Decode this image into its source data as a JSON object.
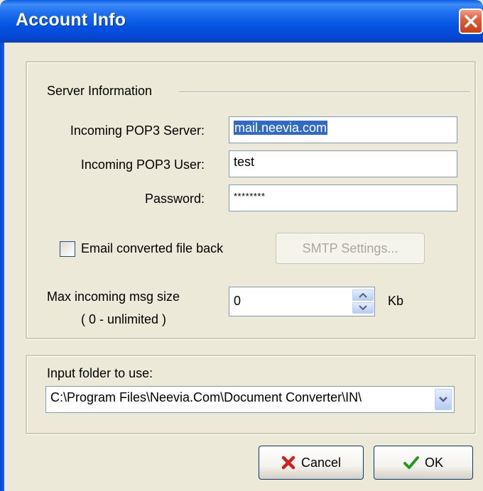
{
  "window": {
    "title": "Account Info"
  },
  "server_info": {
    "group_label": "Server Information",
    "pop3_server_label": "Incoming POP3 Server:",
    "pop3_server_value": "mail.neevia.com",
    "pop3_user_label": "Incoming POP3 User:",
    "pop3_user_value": "test",
    "password_label": "Password:",
    "password_value": "********",
    "email_back_label": "Email converted file back",
    "email_back_checked": false,
    "smtp_button": "SMTP Settings...",
    "max_size_label": "Max incoming msg size",
    "max_size_hint": "( 0 - unlimited )",
    "max_size_value": "0",
    "max_size_unit": "Kb"
  },
  "input_folder": {
    "label": "Input folder to use:",
    "value": "C:\\Program Files\\Neevia.Com\\Document Converter\\IN\\"
  },
  "footer": {
    "cancel_button": "Cancel",
    "ok_button": "OK"
  },
  "icons": {
    "close": "close-icon",
    "cancel": "red-x-icon",
    "ok": "green-check-icon",
    "spin_up": "arrow-up-icon",
    "spin_down": "arrow-down-icon",
    "dropdown": "chevron-down-icon"
  },
  "colors": {
    "titlebar": "#0554e3",
    "dialog_bg": "#ece9d8",
    "selection": "#316ac5"
  }
}
